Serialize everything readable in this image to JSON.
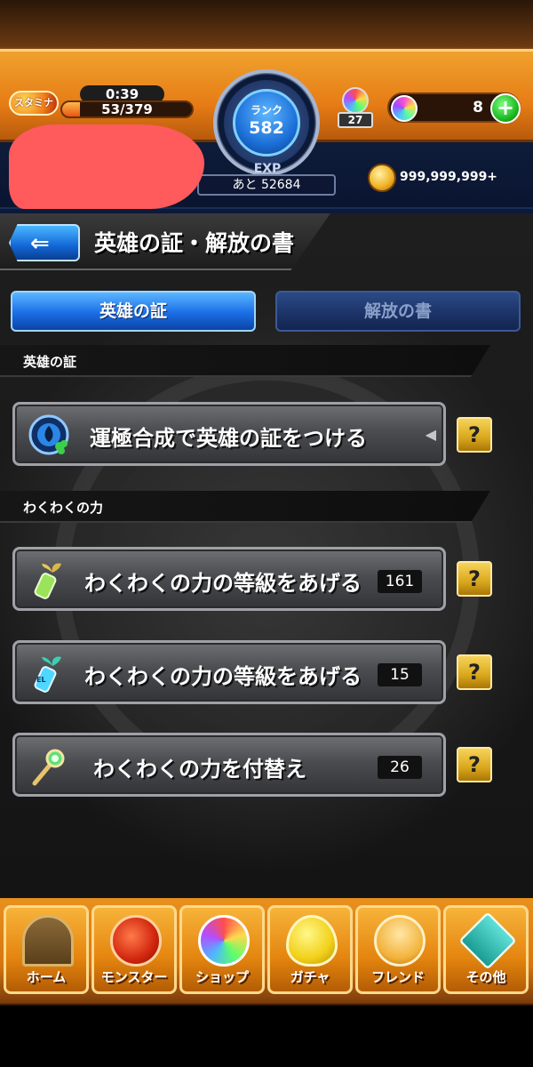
{
  "header": {
    "stamina": {
      "icon_label": "スタミナ",
      "timer": "0:39",
      "value": "53/379",
      "fill_fraction": 0.14
    },
    "rank": {
      "label": "ランク",
      "value": "582",
      "exp_label": "EXP",
      "exp_remaining": "あと 52684"
    },
    "orb_counter": {
      "count": "27",
      "icon": "rainbow-orb-icon"
    },
    "stones": {
      "count": "8",
      "icon": "rainbow-stone-icon",
      "plus_label": "+"
    },
    "gold": {
      "value": "999,999,999+",
      "icon": "gold-coin-icon"
    }
  },
  "page": {
    "back_arrow": "⇐",
    "title": "英雄の証・解放の書"
  },
  "tabs": [
    {
      "label": "英雄の証",
      "active": true
    },
    {
      "label": "解放の書",
      "active": false
    }
  ],
  "sections": [
    {
      "header": "英雄の証",
      "items": [
        {
          "label": "運極合成で英雄の証をつける",
          "count": "",
          "icon": "hero-emblem-clover-icon"
        }
      ]
    },
    {
      "header": "わくわくの力",
      "items": [
        {
          "label": "わくわくの力の等級をあげる",
          "count": "161",
          "icon": "sprout-bottle-icon"
        },
        {
          "label": "わくわくの力の等級をあげる",
          "count": "15",
          "icon": "el-sprout-bottle-icon"
        },
        {
          "label": "わくわくの力を付替え",
          "count": "26",
          "icon": "sprout-key-icon"
        }
      ]
    }
  ],
  "help_label": "?",
  "bottom_nav": [
    {
      "label": "ホーム",
      "icon": "home-gate-icon"
    },
    {
      "label": "モンスター",
      "icon": "monster-icon"
    },
    {
      "label": "ショップ",
      "icon": "shop-orb-icon"
    },
    {
      "label": "ガチャ",
      "icon": "gacha-egg-icon"
    },
    {
      "label": "フレンド",
      "icon": "friends-icon"
    },
    {
      "label": "その他",
      "icon": "other-question-icon"
    }
  ],
  "colors": {
    "accent_orange": "#e98a1a",
    "tab_active_blue": "#1a6ee6",
    "help_yellow": "#d9a71c"
  }
}
